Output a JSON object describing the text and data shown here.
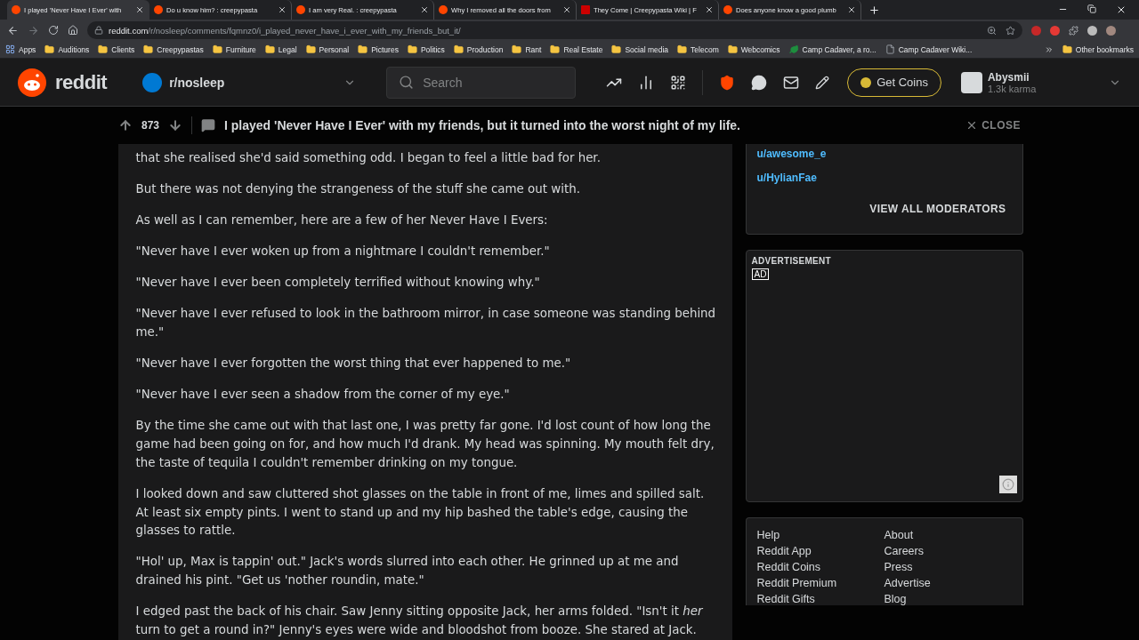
{
  "browser": {
    "tabs": [
      {
        "title": "I played 'Never Have I Ever' with",
        "kind": "reddit",
        "selected": true
      },
      {
        "title": "Do u know him? : creepypasta",
        "kind": "reddit",
        "selected": false
      },
      {
        "title": "I am very Real. : creepypasta",
        "kind": "reddit",
        "selected": false
      },
      {
        "title": "Why I removed all the doors from",
        "kind": "reddit",
        "selected": false
      },
      {
        "title": "They Come | Creepypasta Wiki | F",
        "kind": "wiki",
        "selected": false
      },
      {
        "title": "Does anyone know a good plumb",
        "kind": "reddit",
        "selected": false
      }
    ],
    "url_host": "reddit.com",
    "url_path": "/r/nosleep/comments/fqmnz0/i_played_never_have_i_ever_with_my_friends_but_it/",
    "bookmarks": [
      {
        "label": "Apps",
        "kind": "apps"
      },
      {
        "label": "Auditions",
        "kind": "folder"
      },
      {
        "label": "Clients",
        "kind": "folder"
      },
      {
        "label": "Creepypastas",
        "kind": "folder"
      },
      {
        "label": "Furniture",
        "kind": "folder"
      },
      {
        "label": "Legal",
        "kind": "folder"
      },
      {
        "label": "Personal",
        "kind": "folder"
      },
      {
        "label": "Pictures",
        "kind": "folder"
      },
      {
        "label": "Politics",
        "kind": "folder"
      },
      {
        "label": "Production",
        "kind": "folder"
      },
      {
        "label": "Rant",
        "kind": "folder"
      },
      {
        "label": "Real Estate",
        "kind": "folder"
      },
      {
        "label": "Social media",
        "kind": "folder"
      },
      {
        "label": "Telecom",
        "kind": "folder"
      },
      {
        "label": "Webcomics",
        "kind": "folder"
      },
      {
        "label": "Camp Cadaver, a ro...",
        "kind": "site"
      },
      {
        "label": "Camp Cadaver Wiki...",
        "kind": "page"
      }
    ],
    "other_bookmarks": "Other bookmarks"
  },
  "header": {
    "brand": "reddit",
    "community": "r/nosleep",
    "search": {
      "placeholder": "Search"
    },
    "coins_button": "Get Coins",
    "user": {
      "name": "Abysmii",
      "karma": "1.3k karma"
    }
  },
  "post_bar": {
    "votes": "873",
    "title": "I played 'Never Have I Ever' with my friends, but it turned into the worst night of my life.",
    "close": "CLOSE"
  },
  "post": {
    "paragraphs": [
      "that she realised she'd said something odd. I began to feel a little bad for her.",
      "But there was not denying the strangeness of the stuff she came out with.",
      "As well as I can remember, here are a few of her Never Have I Evers:",
      "\"Never have I ever woken up from a nightmare I couldn't remember.\"",
      "\"Never have I ever been completely terrified without knowing why.\"",
      "\"Never have I ever refused to look in the bathroom mirror, in case someone was standing behind me.\"",
      "\"Never have I ever forgotten the worst thing that ever happened to me.\"",
      "\"Never have I ever seen a shadow from the corner of my eye.\"",
      "By the time she came out with that last one, I was pretty far gone. I'd lost count of how long the game had been going on for, and how much I'd drank. My head was spinning. My mouth felt dry, the taste of tequila I couldn't remember drinking on my tongue.",
      "I looked down and saw cluttered shot glasses on the table in front of me, limes and spilled salt. At least six empty pints. I went to stand up and my hip bashed the table's edge, causing the glasses to rattle.",
      "\"Hol' up, Max is tappin' out.\" Jack's words slurred into each other. He grinned up at me and drained his pint. \"Get us 'nother roundin, mate.\"",
      "I edged past the back of his chair. Saw Jenny sitting opposite Jack, her arms folded. \"Isn't it *her* turn to get a round in?\" Jenny's eyes were wide and bloodshot from booze. She stared at Jack."
    ]
  },
  "sidebar": {
    "moderators": [
      "u/awesome_e",
      "u/HylianFae"
    ],
    "view_all": "VIEW ALL MODERATORS",
    "ad": {
      "label": "ADVERTISEMENT",
      "badge": "AD"
    },
    "footer_links": [
      [
        "Help",
        "Reddit App",
        "Reddit Coins",
        "Reddit Premium",
        "Reddit Gifts"
      ],
      [
        "About",
        "Careers",
        "Press",
        "Advertise",
        "Blog"
      ]
    ]
  }
}
